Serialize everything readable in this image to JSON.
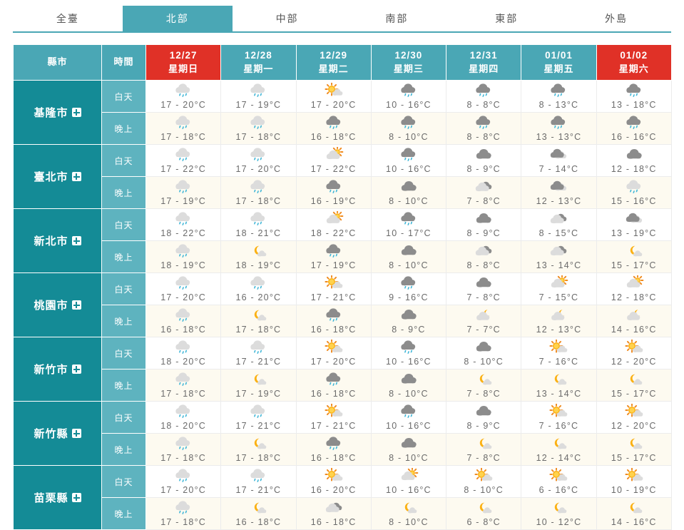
{
  "tabs": [
    {
      "label": "全臺",
      "active": false
    },
    {
      "label": "北部",
      "active": true
    },
    {
      "label": "中部",
      "active": false
    },
    {
      "label": "南部",
      "active": false
    },
    {
      "label": "東部",
      "active": false
    },
    {
      "label": "外島",
      "active": false
    }
  ],
  "table": {
    "col_city": "縣市",
    "col_time": "時間",
    "days": [
      {
        "date": "12/27",
        "week": "星期日",
        "highlight": true
      },
      {
        "date": "12/28",
        "week": "星期一",
        "highlight": false
      },
      {
        "date": "12/29",
        "week": "星期二",
        "highlight": false
      },
      {
        "date": "12/30",
        "week": "星期三",
        "highlight": false
      },
      {
        "date": "12/31",
        "week": "星期四",
        "highlight": false
      },
      {
        "date": "01/01",
        "week": "星期五",
        "highlight": false
      },
      {
        "date": "01/02",
        "week": "星期六",
        "highlight": true
      }
    ],
    "time_day": "白天",
    "time_night": "晚上",
    "cities": [
      {
        "name": "基隆市",
        "day": [
          {
            "icon": "rain-light",
            "temp": "17 - 20°C"
          },
          {
            "icon": "rain-light",
            "temp": "17 - 19°C"
          },
          {
            "icon": "sun-cloud",
            "temp": "17 - 20°C"
          },
          {
            "icon": "rain-dark",
            "temp": "10 - 16°C"
          },
          {
            "icon": "rain-dark",
            "temp": "8 - 8°C"
          },
          {
            "icon": "rain-dark",
            "temp": "8 - 13°C"
          },
          {
            "icon": "rain-dark",
            "temp": "13 - 18°C"
          }
        ],
        "night": [
          {
            "icon": "rain-light",
            "temp": "17 - 18°C"
          },
          {
            "icon": "rain-light",
            "temp": "17 - 18°C"
          },
          {
            "icon": "rain-dark",
            "temp": "16 - 18°C"
          },
          {
            "icon": "rain-dark",
            "temp": "8 - 10°C"
          },
          {
            "icon": "rain-dark",
            "temp": "8 - 8°C"
          },
          {
            "icon": "rain-dark",
            "temp": "13 - 13°C"
          },
          {
            "icon": "rain-dark",
            "temp": "16 - 16°C"
          }
        ]
      },
      {
        "name": "臺北市",
        "day": [
          {
            "icon": "rain-light",
            "temp": "17 - 22°C"
          },
          {
            "icon": "rain-light",
            "temp": "17 - 20°C"
          },
          {
            "icon": "partly-sun",
            "temp": "17 - 22°C"
          },
          {
            "icon": "rain-dark",
            "temp": "10 - 16°C"
          },
          {
            "icon": "cloud-dark",
            "temp": "8 - 9°C"
          },
          {
            "icon": "cloud-mix",
            "temp": "7 - 14°C"
          },
          {
            "icon": "cloud-dark",
            "temp": "12 - 18°C"
          }
        ],
        "night": [
          {
            "icon": "rain-light",
            "temp": "17 - 19°C"
          },
          {
            "icon": "rain-light",
            "temp": "17 - 18°C"
          },
          {
            "icon": "rain-dark",
            "temp": "16 - 19°C"
          },
          {
            "icon": "cloud-dark",
            "temp": "8 - 10°C"
          },
          {
            "icon": "cloud-mix-light",
            "temp": "7 - 8°C"
          },
          {
            "icon": "cloud-mix",
            "temp": "12 - 13°C"
          },
          {
            "icon": "rain-light",
            "temp": "15 - 16°C"
          }
        ]
      },
      {
        "name": "新北市",
        "day": [
          {
            "icon": "rain-light",
            "temp": "18 - 22°C"
          },
          {
            "icon": "rain-light",
            "temp": "18 - 21°C"
          },
          {
            "icon": "partly-sun",
            "temp": "18 - 22°C"
          },
          {
            "icon": "rain-dark",
            "temp": "10 - 17°C"
          },
          {
            "icon": "cloud-dark",
            "temp": "8 - 9°C"
          },
          {
            "icon": "cloud-mix-light",
            "temp": "8 - 15°C"
          },
          {
            "icon": "cloud-mix",
            "temp": "13 - 19°C"
          }
        ],
        "night": [
          {
            "icon": "rain-light",
            "temp": "18 - 19°C"
          },
          {
            "icon": "moon",
            "temp": "18 - 19°C"
          },
          {
            "icon": "rain-dark",
            "temp": "17 - 19°C"
          },
          {
            "icon": "cloud-dark",
            "temp": "8 - 10°C"
          },
          {
            "icon": "cloud-mix-light",
            "temp": "8 - 8°C"
          },
          {
            "icon": "cloud-mix-light",
            "temp": "13 - 14°C"
          },
          {
            "icon": "moon",
            "temp": "15 - 17°C"
          }
        ]
      },
      {
        "name": "桃園市",
        "day": [
          {
            "icon": "rain-light",
            "temp": "17 - 20°C"
          },
          {
            "icon": "rain-light",
            "temp": "16 - 20°C"
          },
          {
            "icon": "sun-cloud",
            "temp": "17 - 21°C"
          },
          {
            "icon": "rain-dark",
            "temp": "9 - 16°C"
          },
          {
            "icon": "cloud-dark",
            "temp": "7 - 8°C"
          },
          {
            "icon": "partly-sun",
            "temp": "7 - 15°C"
          },
          {
            "icon": "partly-sun",
            "temp": "12 - 18°C"
          }
        ],
        "night": [
          {
            "icon": "rain-light",
            "temp": "16 - 18°C"
          },
          {
            "icon": "moon",
            "temp": "17 - 18°C"
          },
          {
            "icon": "rain-dark",
            "temp": "16 - 18°C"
          },
          {
            "icon": "cloud-dark",
            "temp": "8 - 9°C"
          },
          {
            "icon": "moon-cloud",
            "temp": "7 - 7°C"
          },
          {
            "icon": "moon-cloud",
            "temp": "12 - 13°C"
          },
          {
            "icon": "moon-cloud",
            "temp": "14 - 16°C"
          }
        ]
      },
      {
        "name": "新竹市",
        "day": [
          {
            "icon": "rain-light",
            "temp": "18 - 20°C"
          },
          {
            "icon": "rain-light",
            "temp": "17 - 21°C"
          },
          {
            "icon": "sun-cloud",
            "temp": "17 - 20°C"
          },
          {
            "icon": "rain-dark",
            "temp": "10 - 16°C"
          },
          {
            "icon": "cloud-dark",
            "temp": "8 - 10°C"
          },
          {
            "icon": "sun-cloud",
            "temp": "7 - 16°C"
          },
          {
            "icon": "sun-cloud",
            "temp": "12 - 20°C"
          }
        ],
        "night": [
          {
            "icon": "rain-light",
            "temp": "17 - 18°C"
          },
          {
            "icon": "moon",
            "temp": "17 - 19°C"
          },
          {
            "icon": "rain-dark",
            "temp": "16 - 18°C"
          },
          {
            "icon": "cloud-dark",
            "temp": "8 - 10°C"
          },
          {
            "icon": "moon",
            "temp": "7 - 8°C"
          },
          {
            "icon": "moon",
            "temp": "13 - 14°C"
          },
          {
            "icon": "moon",
            "temp": "15 - 17°C"
          }
        ]
      },
      {
        "name": "新竹縣",
        "day": [
          {
            "icon": "rain-light",
            "temp": "18 - 20°C"
          },
          {
            "icon": "rain-light",
            "temp": "17 - 21°C"
          },
          {
            "icon": "sun-cloud",
            "temp": "17 - 21°C"
          },
          {
            "icon": "rain-dark",
            "temp": "10 - 16°C"
          },
          {
            "icon": "cloud-dark",
            "temp": "8 - 9°C"
          },
          {
            "icon": "sun-cloud",
            "temp": "7 - 16°C"
          },
          {
            "icon": "sun-cloud",
            "temp": "12 - 20°C"
          }
        ],
        "night": [
          {
            "icon": "rain-light",
            "temp": "17 - 18°C"
          },
          {
            "icon": "moon",
            "temp": "17 - 18°C"
          },
          {
            "icon": "rain-dark",
            "temp": "16 - 18°C"
          },
          {
            "icon": "cloud-dark",
            "temp": "8 - 10°C"
          },
          {
            "icon": "moon",
            "temp": "7 - 8°C"
          },
          {
            "icon": "moon",
            "temp": "12 - 14°C"
          },
          {
            "icon": "moon",
            "temp": "15 - 17°C"
          }
        ]
      },
      {
        "name": "苗栗縣",
        "day": [
          {
            "icon": "rain-light",
            "temp": "17 - 20°C"
          },
          {
            "icon": "rain-light",
            "temp": "17 - 21°C"
          },
          {
            "icon": "sun-cloud",
            "temp": "16 - 20°C"
          },
          {
            "icon": "partly-sun",
            "temp": "10 - 16°C"
          },
          {
            "icon": "sun-cloud",
            "temp": "8 - 10°C"
          },
          {
            "icon": "sun-cloud",
            "temp": "6 - 16°C"
          },
          {
            "icon": "sun-cloud",
            "temp": "10 - 19°C"
          }
        ],
        "night": [
          {
            "icon": "rain-light",
            "temp": "17 - 18°C"
          },
          {
            "icon": "moon",
            "temp": "16 - 18°C"
          },
          {
            "icon": "cloud-mix-light",
            "temp": "16 - 18°C"
          },
          {
            "icon": "moon",
            "temp": "8 - 10°C"
          },
          {
            "icon": "moon",
            "temp": "6 - 8°C"
          },
          {
            "icon": "moon",
            "temp": "10 - 12°C"
          },
          {
            "icon": "moon",
            "temp": "14 - 16°C"
          }
        ]
      }
    ]
  },
  "colors": {
    "tab_active": "#4aa7b5",
    "header_teal": "#4aa7b5",
    "header_red": "#e03127",
    "city_teal": "#148b96",
    "time_teal": "#5eb3bf",
    "night_row": "#fdfaf0",
    "sun": "#f5a623",
    "moon": "#f5a623",
    "rain_drop": "#3bb4d6",
    "cloud_light": "#dcdcdc",
    "cloud_dark": "#8c8c8c",
    "temp_text": "#6b6b6b"
  }
}
